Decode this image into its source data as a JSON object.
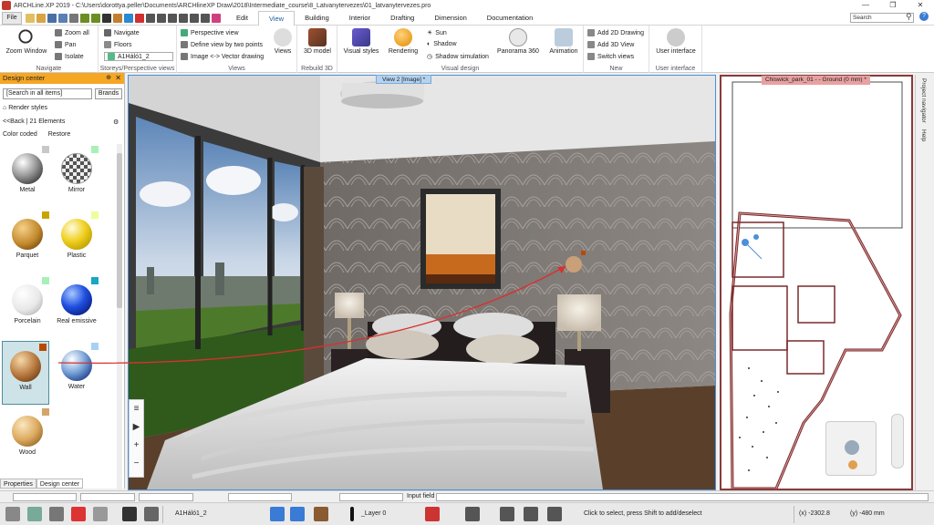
{
  "window": {
    "title": "ARCHLine.XP 2019 - C:\\Users\\dorottya.peller\\Documents\\ARCHlineXP Draw\\2018\\Intermediate_course\\8_Latvanytervezes\\01_latvanytervezes.pro",
    "minimize": "—",
    "restore": "❐",
    "close": "✕"
  },
  "ribbon_tabs": [
    "Edit",
    "View",
    "Building",
    "Interior",
    "Drafting",
    "Dimension",
    "Documentation"
  ],
  "active_tab": "View",
  "file_button": "File",
  "search_placeholder": "Search",
  "ribbon": {
    "navigate": {
      "label": "Navigate",
      "zoom_window": "Zoom Window",
      "zoom_all": "Zoom all",
      "pan": "Pan",
      "isolate": "Isolate"
    },
    "storeys": {
      "label": "Storeys/Perspective views",
      "navigate": "Navigate",
      "floors": "Floors",
      "layer_select": "A1Háló1_2"
    },
    "views": {
      "label": "Views",
      "perspective_view": "Perspective view",
      "define_view": "Define view by two points",
      "image_vector": "Image <-> Vector drawing",
      "views_btn": "Views"
    },
    "rebuild": {
      "label": "Rebuild 3D",
      "btn": "3D model"
    },
    "visual": {
      "label": "Visual design",
      "visual_styles": "Visual styles",
      "rendering": "Rendering",
      "sun": "Sun",
      "shadow": "Shadow",
      "shadow_sim": "Shadow simulation",
      "panorama": "Panorama 360",
      "animation": "Animation"
    },
    "new": {
      "label": "New",
      "add2d": "Add 2D Drawing",
      "add3d": "Add 3D View",
      "switch": "Switch views"
    },
    "ui": {
      "label": "User interface",
      "btn": "User interface"
    }
  },
  "design_center": {
    "title": "Design center",
    "search_placeholder": "[Search in all items]",
    "brands": "Brands",
    "breadcrumb": "Render styles",
    "back": "<<Back",
    "count": "| 21 Elements",
    "color_coded": "Color coded",
    "restore": "Restore",
    "materials": [
      {
        "name": "Metal",
        "swatch": "#c8c8c8"
      },
      {
        "name": "Mirror",
        "swatch": "#a9f0b8"
      },
      {
        "name": "Parquet",
        "swatch": "#c8a400"
      },
      {
        "name": "Plastic",
        "swatch": "#eaff9a"
      },
      {
        "name": "Porcelain",
        "swatch": "#a9f0b8"
      },
      {
        "name": "Real emissive",
        "swatch": "#1aa6c4"
      },
      {
        "name": "Wall",
        "swatch": "#b84a00"
      },
      {
        "name": "Water",
        "swatch": "#a8d0f5"
      },
      {
        "name": "Wood",
        "swatch": "#d4a56a"
      }
    ],
    "tabs": [
      "Properties",
      "Design center"
    ]
  },
  "view3d": {
    "title": "View 2 [Image] *"
  },
  "plan_view": {
    "title": "Chiswick_park_01 - - Ground (0 mm) *"
  },
  "right_strip": [
    "Project navigator",
    "Help"
  ],
  "command_bar": {
    "input_field": "Input field"
  },
  "status": {
    "layer_select": "A1Háló1_2",
    "layer_name": "_Layer 0",
    "hint": "Click to select, press Shift to add/deselect",
    "x_coord": "(x) -2302.8",
    "y_coord": "(y) -480 mm"
  }
}
